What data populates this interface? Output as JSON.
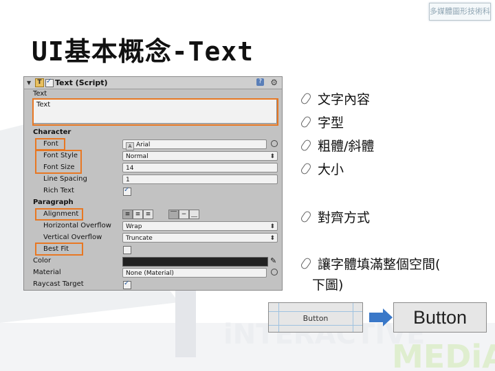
{
  "logo_text": "多媒體圖形技術科",
  "slide_title": "UI基本概念-Text",
  "inspector": {
    "component_title": "Text (Script)",
    "text_label": "Text",
    "text_value": "Text",
    "character_section": "Character",
    "font_label": "Font",
    "font_value": "Arial",
    "font_style_label": "Font Style",
    "font_style_value": "Normal",
    "font_size_label": "Font Size",
    "font_size_value": "14",
    "line_spacing_label": "Line Spacing",
    "line_spacing_value": "1",
    "rich_text_label": "Rich Text",
    "rich_text_checked": true,
    "paragraph_section": "Paragraph",
    "alignment_label": "Alignment",
    "horizontal_overflow_label": "Horizontal Overflow",
    "horizontal_overflow_value": "Wrap",
    "vertical_overflow_label": "Vertical Overflow",
    "vertical_overflow_value": "Truncate",
    "best_fit_label": "Best Fit",
    "best_fit_checked": false,
    "color_label": "Color",
    "color_value": "#222222",
    "material_label": "Material",
    "material_value": "None (Material)",
    "raycast_target_label": "Raycast Target",
    "raycast_checked": true
  },
  "bullets": [
    "文字內容",
    "字型",
    "粗體/斜體",
    "大小",
    "對齊方式",
    "讓字體填滿整個空間(",
    "下圖)"
  ],
  "example": {
    "small_button_label": "Button",
    "big_button_label": "Button"
  },
  "colors": {
    "highlight": "#e87722",
    "arrow": "#3a78c8",
    "inspector_bg": "#c2c2c2"
  }
}
